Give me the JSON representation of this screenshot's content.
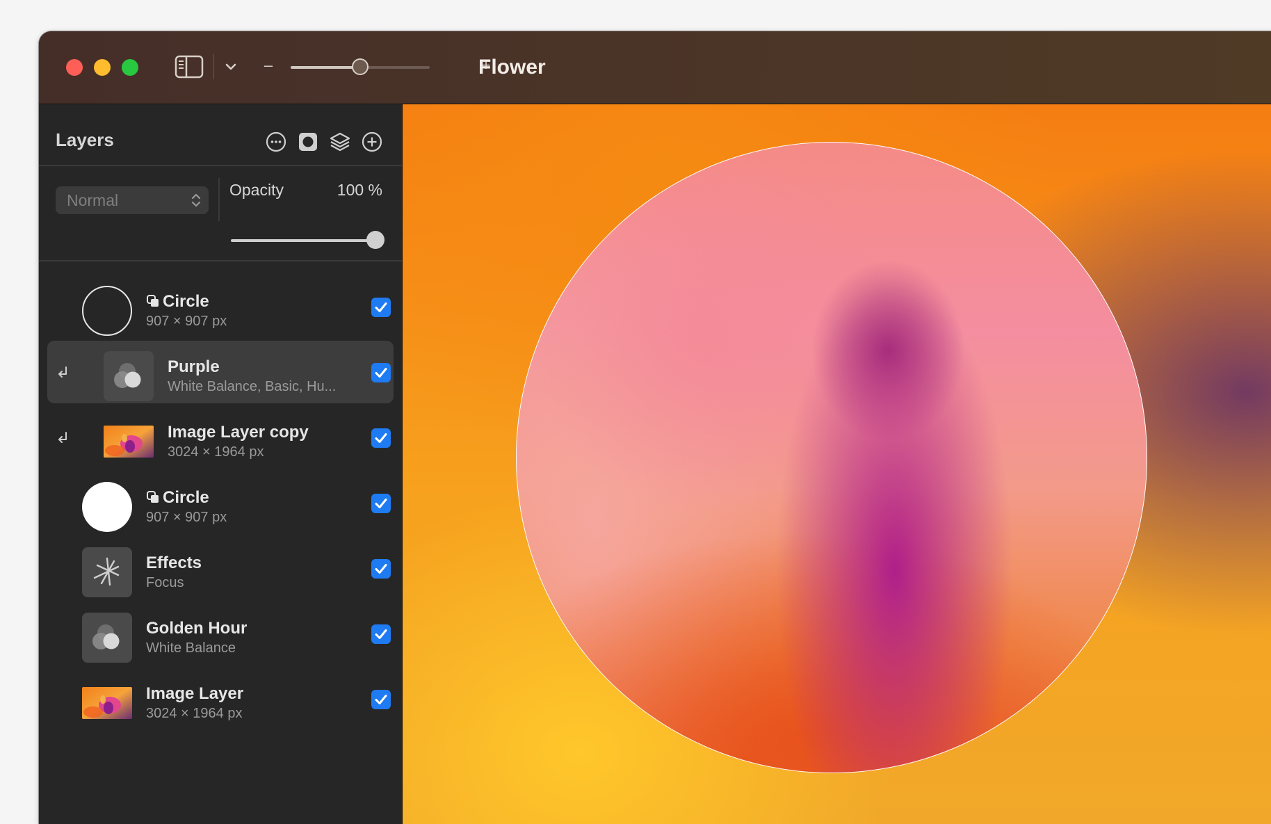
{
  "window": {
    "title": "Flower",
    "traffic_lights": [
      "close",
      "minimize",
      "zoom"
    ]
  },
  "toolbar": {
    "sidebar_toggle_icon": "sidebar-icon",
    "dropdown_icon": "chevron-down-icon",
    "zoom_out_label": "–",
    "zoom_in_label": "+",
    "zoom_level": 0.5
  },
  "layers_panel": {
    "title": "Layers",
    "header_icons": [
      "more-icon",
      "mask-icon",
      "layers-stack-icon",
      "add-icon"
    ],
    "blend_mode": "Normal",
    "opacity_label": "Opacity",
    "opacity_value": "100 %",
    "opacity_fraction": 1.0,
    "layers": [
      {
        "name": "Circle",
        "detail": "907 × 907 px",
        "kind": "shape-outline",
        "clipped": false,
        "visible": true,
        "selected": false
      },
      {
        "name": "Purple",
        "detail": "White Balance, Basic, Hu...",
        "kind": "adjustment",
        "clipped": true,
        "visible": true,
        "selected": true
      },
      {
        "name": "Image Layer copy",
        "detail": "3024 × 1964 px",
        "kind": "image",
        "clipped": true,
        "visible": true,
        "selected": false
      },
      {
        "name": "Circle",
        "detail": "907 × 907 px",
        "kind": "shape-filled",
        "clipped": false,
        "visible": true,
        "selected": false
      },
      {
        "name": "Effects",
        "detail": "Focus",
        "kind": "effects",
        "clipped": false,
        "visible": true,
        "selected": false
      },
      {
        "name": "Golden Hour",
        "detail": "White Balance",
        "kind": "adjustment",
        "clipped": false,
        "visible": true,
        "selected": false
      },
      {
        "name": "Image Layer",
        "detail": "3024 × 1964 px",
        "kind": "image",
        "clipped": false,
        "visible": true,
        "selected": false
      }
    ]
  },
  "colors": {
    "accent": "#1f7bf2",
    "panel_bg": "#262626",
    "selected_row": "#3d3d3d"
  }
}
